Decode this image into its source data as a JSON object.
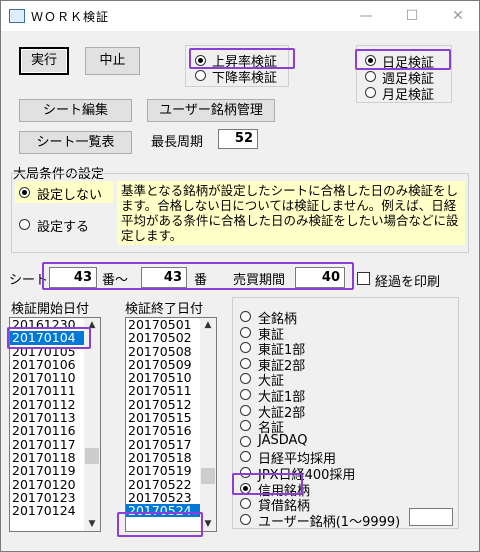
{
  "window": {
    "title": "ＷＯＲＫ検証"
  },
  "titlebar": {
    "minimize": "—",
    "maximize": "☐",
    "close": "✕"
  },
  "toolbar": {
    "run_label": "実行",
    "stop_label": "中止"
  },
  "direction": {
    "options": [
      "上昇率検証",
      "下降率検証"
    ],
    "selected": 0
  },
  "period": {
    "options": [
      "日足検証",
      "週足検証",
      "月足検証"
    ],
    "selected": 0
  },
  "actions": {
    "sheet_edit": "シート編集",
    "user_stock_mgmt": "ユーザー銘柄管理",
    "sheet_list": "シート一覧表"
  },
  "max_cycle": {
    "label": "最長周期",
    "value": "52"
  },
  "market_condition": {
    "title": "大局条件の設定",
    "options": [
      "設定しない",
      "設定する"
    ],
    "selected": 0,
    "description": "基準となる銘柄が設定したシートに合格した日のみ検証をします。合格しない日については検証しません。例えば、日経平均がある条件に合格した日のみ検証をしたい場合などに設定します。"
  },
  "sheet_range": {
    "sheet_label": "シート",
    "from_value": "43",
    "to_label": "番〜",
    "to_value": "43",
    "ban_label": "番",
    "holding_label": "売買期間",
    "holding_value": "40",
    "print_label": "経過を印刷"
  },
  "start_dates": {
    "label": "検証開始日付",
    "items": [
      "20161230",
      "20170104",
      "20170105",
      "20170106",
      "20170110",
      "20170111",
      "20170112",
      "20170113",
      "20170116",
      "20170117",
      "20170118",
      "20170119",
      "20170120",
      "20170123",
      "20170124"
    ],
    "selected": 1
  },
  "end_dates": {
    "label": "検証終了日付",
    "items": [
      "20170501",
      "20170502",
      "20170508",
      "20170509",
      "20170510",
      "20170511",
      "20170512",
      "20170515",
      "20170516",
      "20170517",
      "20170518",
      "20170519",
      "20170522",
      "20170523",
      "20170524"
    ],
    "selected": 14
  },
  "markets": {
    "options": [
      "全銘柄",
      "東証",
      "東証1部",
      "東証2部",
      "大証",
      "大証1部",
      "大証2部",
      "名証",
      "JASDAQ",
      "日経平均採用",
      "JPX日経400採用",
      "信用銘柄",
      "貸借銘柄",
      "ユーザー銘柄(1〜9999)"
    ],
    "selected": 11
  },
  "colors": {
    "highlight": "#8b3fd6",
    "selection": "#0078d7",
    "note_bg": "#ffffc8"
  }
}
